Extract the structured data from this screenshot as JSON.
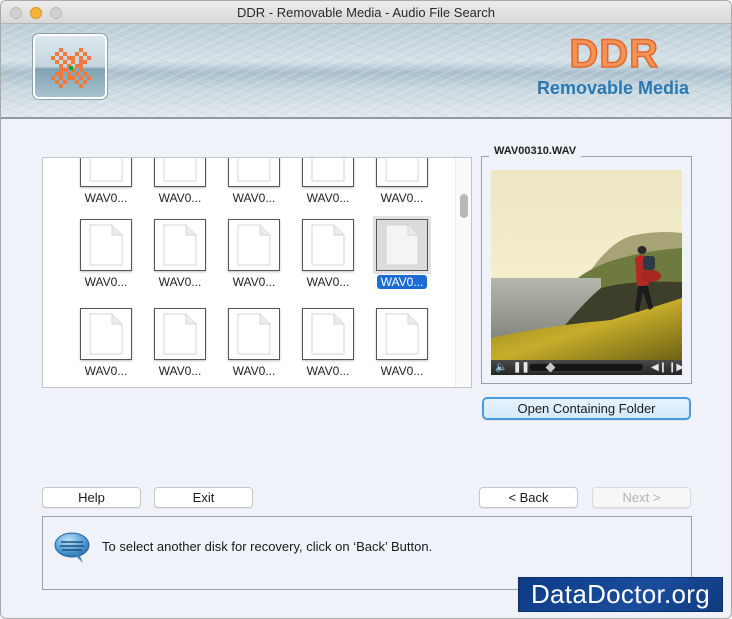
{
  "window": {
    "title": "DDR - Removable Media - Audio File Search"
  },
  "banner": {
    "brand_title": "DDR",
    "brand_subtitle": "Removable Media"
  },
  "file_grid": {
    "items": [
      {
        "label": "WAV0...",
        "selected": false
      },
      {
        "label": "WAV0...",
        "selected": false
      },
      {
        "label": "WAV0...",
        "selected": false
      },
      {
        "label": "WAV0...",
        "selected": false
      },
      {
        "label": "WAV0...",
        "selected": false
      },
      {
        "label": "WAV0...",
        "selected": false
      },
      {
        "label": "WAV0...",
        "selected": false
      },
      {
        "label": "WAV0...",
        "selected": false
      },
      {
        "label": "WAV0...",
        "selected": false
      },
      {
        "label": "WAV0...",
        "selected": true
      },
      {
        "label": "WAV0...",
        "selected": false
      },
      {
        "label": "WAV0...",
        "selected": false
      },
      {
        "label": "WAV0...",
        "selected": false
      },
      {
        "label": "WAV0...",
        "selected": false
      },
      {
        "label": "WAV0...",
        "selected": false
      }
    ]
  },
  "preview": {
    "filename": "WAV00310.WAV",
    "playback_position": 0.15,
    "open_folder_label": "Open Containing Folder"
  },
  "buttons": {
    "help": "Help",
    "exit": "Exit",
    "back": "< Back",
    "next": "Next >"
  },
  "message": {
    "text": "To select another disk for recovery, click on ‘Back’ Button."
  },
  "watermark": {
    "text": "DataDoctor.org"
  },
  "colors": {
    "selection": "#1e6bd1",
    "brand_orange": "#f49358",
    "brand_blue": "#2a79b2"
  }
}
